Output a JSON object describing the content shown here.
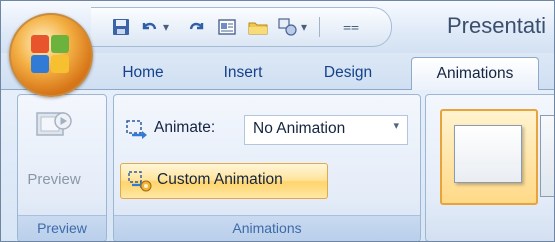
{
  "window": {
    "title": "Presentati"
  },
  "tabs": [
    {
      "label": "Home"
    },
    {
      "label": "Insert"
    },
    {
      "label": "Design"
    },
    {
      "label": "Animations"
    }
  ],
  "preview_group": {
    "button_label": "Preview",
    "group_label": "Preview"
  },
  "animations_group": {
    "animate_label": "Animate:",
    "animate_value": "No Animation",
    "custom_animation_label": "Custom Animation",
    "group_label": "Animations"
  },
  "icons": {
    "office_button": "office-logo-icon",
    "save": "save-icon",
    "undo": "undo-icon",
    "redo": "redo-icon",
    "print_preview": "print-preview-icon",
    "open": "open-folder-icon",
    "shapes": "shapes-icon",
    "customize": "customize-qat-icon"
  },
  "colors": {
    "tab_text": "#15428b",
    "highlight": "#ffd46b",
    "group_label": "#3e6aaa"
  }
}
